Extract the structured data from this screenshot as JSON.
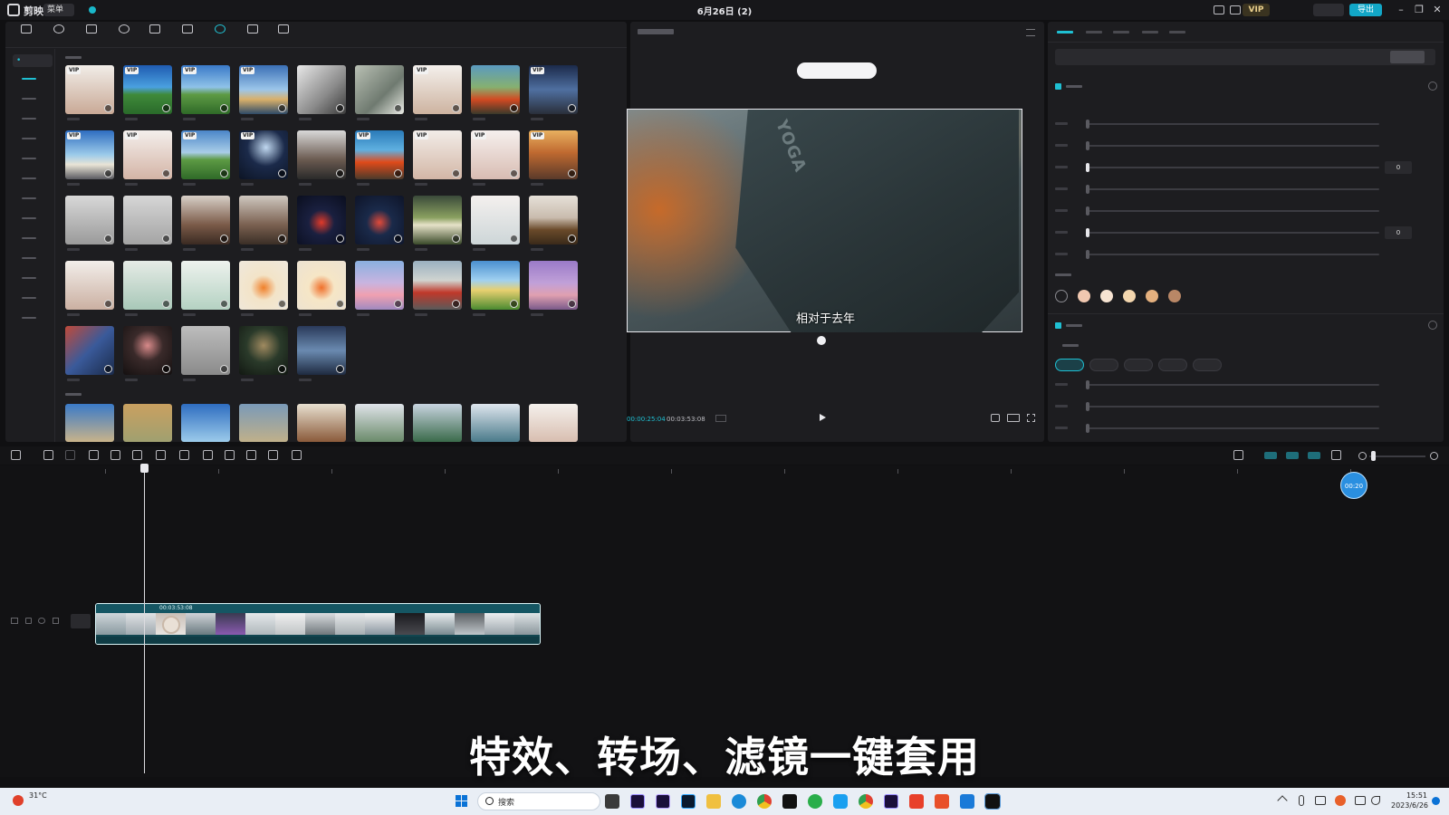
{
  "window": {
    "app_name": "剪映",
    "menu_label": "菜单",
    "project_title": "6月26日 (2)",
    "vip_label": "VIP",
    "export_label": "导出"
  },
  "player": {
    "caption": "相对于去年",
    "brand_on_laptop": "YOGA",
    "timecode_current": "00:00:25:04",
    "timecode_total": "00:03:53:08"
  },
  "properties": {
    "slider_values": [
      "0",
      "0"
    ]
  },
  "timeline": {
    "playhead_badge": "00:20",
    "clip_duration": "00:03:53:08"
  },
  "overlay": {
    "promo_caption": "特效、转场、滤镜一键套用"
  },
  "taskbar": {
    "temperature": "31°C",
    "search_placeholder": "搜索",
    "clock_time": "15:51",
    "clock_date": "2023/6/26"
  },
  "colors": {
    "accent": "#1fc0d3",
    "panel": "#1d1d20",
    "background": "#101012"
  }
}
